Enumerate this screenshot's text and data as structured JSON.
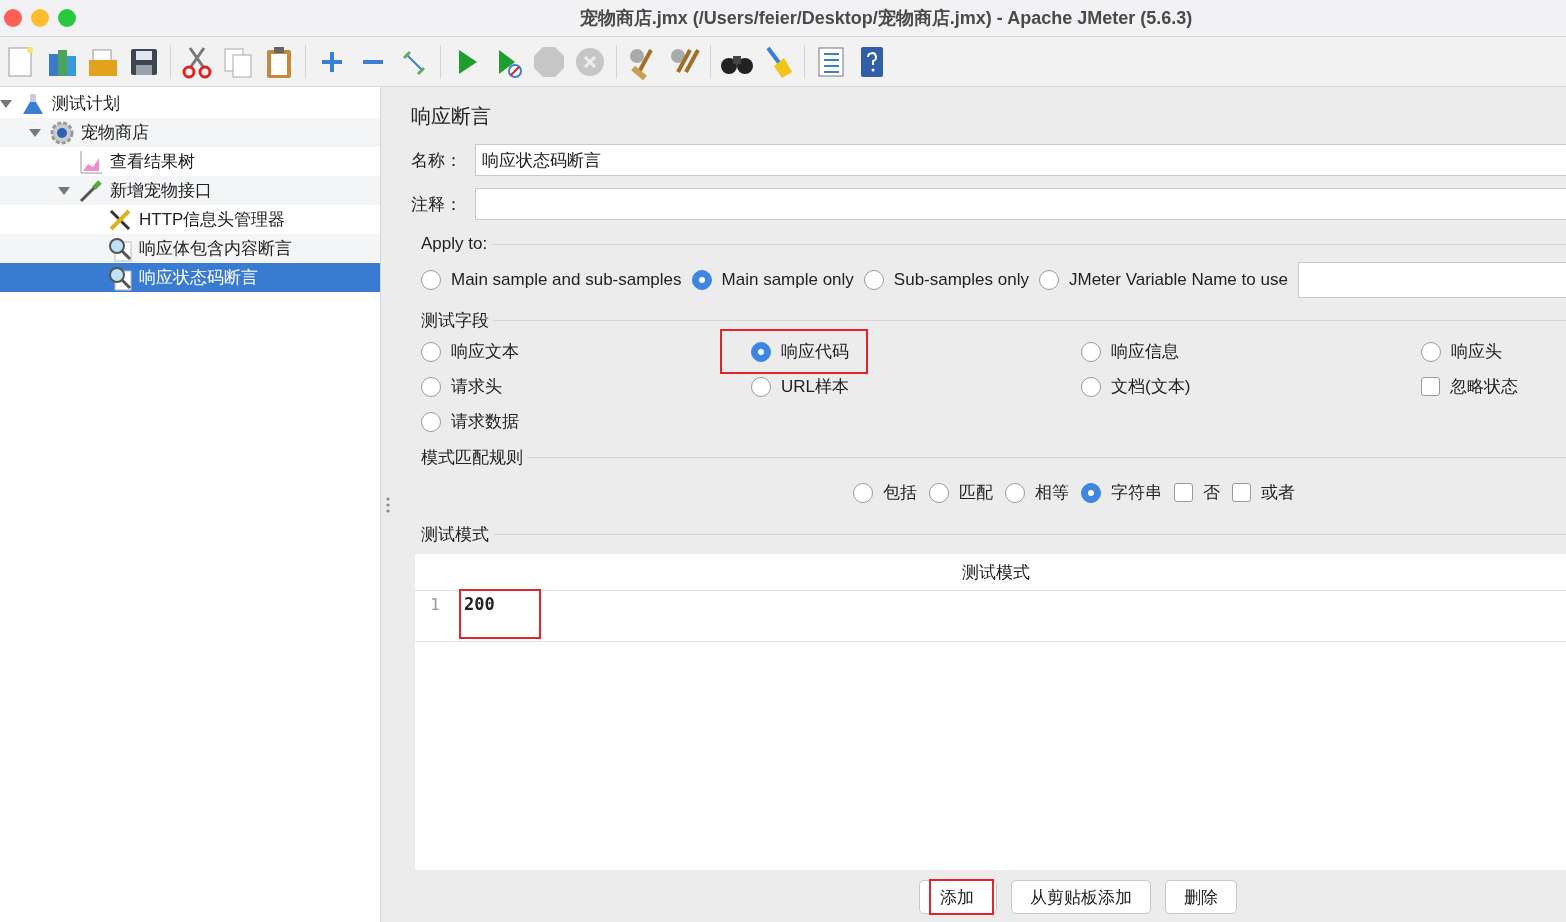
{
  "window": {
    "title": "宠物商店.jmx (/Users/feier/Desktop/宠物商店.jmx) - Apache JMeter (5.6.3)"
  },
  "tree": [
    {
      "label": "测试计划",
      "kind": "plan",
      "expanded": true,
      "selected": false,
      "children": [
        {
          "label": "宠物商店",
          "kind": "group",
          "expanded": true,
          "selected": false,
          "children": [
            {
              "label": "查看结果树",
              "kind": "listener",
              "selected": false
            },
            {
              "label": "新增宠物接口",
              "kind": "sampler",
              "expanded": true,
              "selected": false,
              "children": [
                {
                  "label": "HTTP信息头管理器",
                  "kind": "config",
                  "selected": false
                },
                {
                  "label": "响应体包含内容断言",
                  "kind": "assertion",
                  "selected": false
                },
                {
                  "label": "响应状态码断言",
                  "kind": "assertion",
                  "selected": true
                }
              ]
            }
          ]
        }
      ]
    }
  ],
  "panel": {
    "title": "响应断言",
    "name_label": "名称：",
    "name_value": "响应状态码断言",
    "comment_label": "注释：",
    "apply_to": {
      "legend": "Apply to:",
      "options": [
        {
          "label": "Main sample and sub-samples",
          "selected": false
        },
        {
          "label": "Main sample only",
          "selected": true
        },
        {
          "label": "Sub-samples only",
          "selected": false
        },
        {
          "label": "JMeter Variable Name to use",
          "selected": false
        }
      ]
    },
    "test_field": {
      "legend": "测试字段",
      "options": [
        {
          "label": "响应文本",
          "kind": "radio",
          "selected": false,
          "highlighted": false
        },
        {
          "label": "响应代码",
          "kind": "radio",
          "selected": true,
          "highlighted": true
        },
        {
          "label": "响应信息",
          "kind": "radio",
          "selected": false,
          "highlighted": false
        },
        {
          "label": "响应头",
          "kind": "radio",
          "selected": false,
          "highlighted": false
        },
        {
          "label": "请求头",
          "kind": "radio",
          "selected": false,
          "highlighted": false
        },
        {
          "label": "URL样本",
          "kind": "radio",
          "selected": false,
          "highlighted": false
        },
        {
          "label": "文档(文本)",
          "kind": "radio",
          "selected": false,
          "highlighted": false
        },
        {
          "label": "忽略状态",
          "kind": "checkbox",
          "checked": false,
          "highlighted": false
        },
        {
          "label": "请求数据",
          "kind": "radio",
          "selected": false,
          "highlighted": false
        }
      ]
    },
    "pattern_rule": {
      "legend": "模式匹配规则",
      "options": [
        {
          "label": "包括",
          "kind": "radio",
          "selected": false
        },
        {
          "label": "匹配",
          "kind": "radio",
          "selected": false
        },
        {
          "label": "相等",
          "kind": "radio",
          "selected": false
        },
        {
          "label": "字符串",
          "kind": "radio",
          "selected": true
        },
        {
          "label": "否",
          "kind": "checkbox",
          "checked": false
        },
        {
          "label": "或者",
          "kind": "checkbox",
          "checked": false
        }
      ]
    },
    "test_pattern": {
      "legend": "测试模式",
      "column": "测试模式",
      "rows": [
        {
          "line": "1",
          "value": "200",
          "highlighted": true
        }
      ]
    },
    "buttons": [
      {
        "label": "添加",
        "highlighted": true
      },
      {
        "label": "从剪贴板添加",
        "highlighted": false
      },
      {
        "label": "删除",
        "highlighted": false
      }
    ]
  }
}
